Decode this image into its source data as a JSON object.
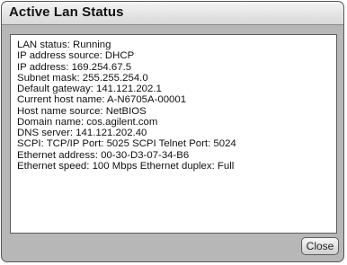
{
  "window": {
    "title": "Active Lan Status"
  },
  "status_lines": [
    "LAN status: Running",
    "IP address source: DHCP",
    "IP address: 169.254.67.5",
    "Subnet mask: 255.255.254.0",
    "Default gateway: 141.121.202.1",
    "Current host name: A-N6705A-00001",
    "Host name source: NetBIOS",
    "Domain name: cos.agilent.com",
    "DNS server: 141.121.202.40",
    "SCPI: TCP/IP Port: 5025  SCPI Telnet Port: 5024",
    "Ethernet address: 00-30-D3-07-34-B6",
    "Ethernet speed: 100 Mbps  Ethernet duplex: Full"
  ],
  "buttons": {
    "close_label": "Close"
  },
  "colors": {
    "window_background": "#b7b7b7",
    "content_background": "#ffffff"
  }
}
